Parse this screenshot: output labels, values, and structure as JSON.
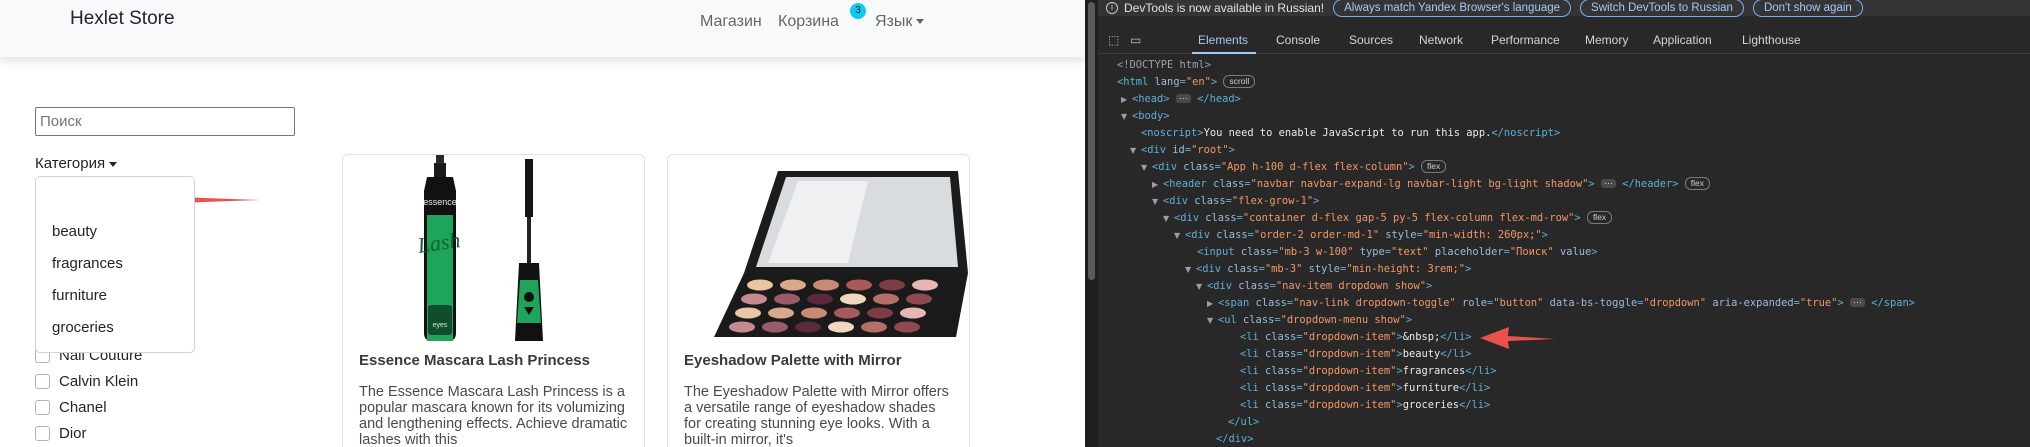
{
  "store": {
    "brand": "Hexlet Store",
    "nav": {
      "shop": "Магазин",
      "cart": "Корзина",
      "cart_count": "3",
      "language": "Язык"
    },
    "search": {
      "placeholder": "Поиск",
      "value": ""
    },
    "category": {
      "toggle_label": "Категория",
      "items": [
        "beauty",
        "fragrances",
        "furniture",
        "groceries"
      ]
    },
    "brands": [
      "Nail Couture",
      "Calvin Klein",
      "Chanel",
      "Dior"
    ],
    "products": [
      {
        "title": "Essence Mascara Lash Princess",
        "description": "The Essence Mascara Lash Princess is a popular mascara known for its volumizing and lengthening effects. Achieve dramatic lashes with this",
        "image_label": "essence Lash PRINCESS"
      },
      {
        "title": "Eyeshadow Palette with Mirror",
        "description": "The Eyeshadow Palette with Mirror offers a versatile range of eyeshadow shades for creating stunning eye looks. With a built-in mirror, it's"
      }
    ]
  },
  "devtools": {
    "infobar": {
      "message": "DevTools is now available in Russian!",
      "buttons": [
        "Always match Yandex Browser's language",
        "Switch DevTools to Russian",
        "Don't show again"
      ]
    },
    "tabs": [
      "Elements",
      "Console",
      "Sources",
      "Network",
      "Performance",
      "Memory",
      "Application",
      "Lighthouse"
    ],
    "active_tab": "Elements"
  },
  "colors": {
    "navbar_bg": "#f8f9fa",
    "badge": "#0dcaf0",
    "arrow": "#e8524a",
    "devtools_bg": "#282828",
    "devtools_accent": "#a8c7fa",
    "tag": "#5db0d7",
    "attr_value": "#f29766"
  }
}
